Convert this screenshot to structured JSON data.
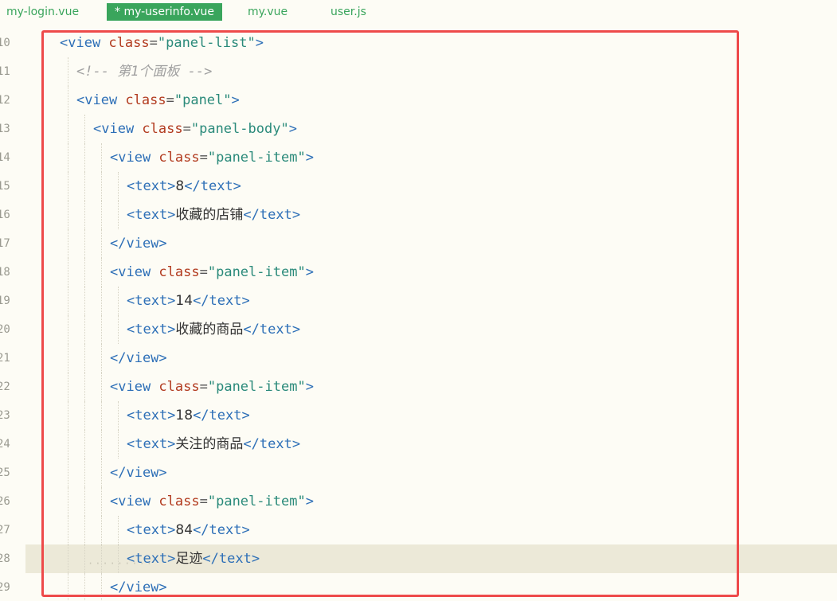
{
  "tabs": [
    {
      "label": "my-login.vue",
      "active": false
    },
    {
      "label": "* my-userinfo.vue",
      "active": true
    },
    {
      "label": "my.vue",
      "active": false
    },
    {
      "label": "user.js",
      "active": false
    }
  ],
  "lines": [
    {
      "num": "10",
      "indent": 0,
      "tokens": [
        [
          "tag",
          "<view "
        ],
        [
          "attr",
          "class"
        ],
        [
          "eq",
          "="
        ],
        [
          "str",
          "\"panel-list\""
        ],
        [
          "tag",
          ">"
        ]
      ]
    },
    {
      "num": "11",
      "indent": 1,
      "tokens": [
        [
          "cmt",
          "<!-- 第1个面板 -->"
        ]
      ]
    },
    {
      "num": "12",
      "indent": 1,
      "tokens": [
        [
          "tag",
          "<view "
        ],
        [
          "attr",
          "class"
        ],
        [
          "eq",
          "="
        ],
        [
          "str",
          "\"panel\""
        ],
        [
          "tag",
          ">"
        ]
      ]
    },
    {
      "num": "13",
      "indent": 2,
      "tokens": [
        [
          "tag",
          "<view "
        ],
        [
          "attr",
          "class"
        ],
        [
          "eq",
          "="
        ],
        [
          "str",
          "\"panel-body\""
        ],
        [
          "tag",
          ">"
        ]
      ]
    },
    {
      "num": "14",
      "indent": 3,
      "tokens": [
        [
          "tag",
          "<view "
        ],
        [
          "attr",
          "class"
        ],
        [
          "eq",
          "="
        ],
        [
          "str",
          "\"panel-item\""
        ],
        [
          "tag",
          ">"
        ]
      ]
    },
    {
      "num": "15",
      "indent": 4,
      "tokens": [
        [
          "tag",
          "<text>"
        ],
        [
          "txt",
          "8"
        ],
        [
          "tag",
          "</text>"
        ]
      ]
    },
    {
      "num": "16",
      "indent": 4,
      "tokens": [
        [
          "tag",
          "<text>"
        ],
        [
          "txt",
          "收藏的店铺"
        ],
        [
          "tag",
          "</text>"
        ]
      ]
    },
    {
      "num": "17",
      "indent": 3,
      "tokens": [
        [
          "tag",
          "</view>"
        ]
      ]
    },
    {
      "num": "18",
      "indent": 3,
      "tokens": [
        [
          "tag",
          "<view "
        ],
        [
          "attr",
          "class"
        ],
        [
          "eq",
          "="
        ],
        [
          "str",
          "\"panel-item\""
        ],
        [
          "tag",
          ">"
        ]
      ]
    },
    {
      "num": "19",
      "indent": 4,
      "tokens": [
        [
          "tag",
          "<text>"
        ],
        [
          "txt",
          "14"
        ],
        [
          "tag",
          "</text>"
        ]
      ]
    },
    {
      "num": "20",
      "indent": 4,
      "tokens": [
        [
          "tag",
          "<text>"
        ],
        [
          "txt",
          "收藏的商品"
        ],
        [
          "tag",
          "</text>"
        ]
      ]
    },
    {
      "num": "21",
      "indent": 3,
      "tokens": [
        [
          "tag",
          "</view>"
        ]
      ]
    },
    {
      "num": "22",
      "indent": 3,
      "tokens": [
        [
          "tag",
          "<view "
        ],
        [
          "attr",
          "class"
        ],
        [
          "eq",
          "="
        ],
        [
          "str",
          "\"panel-item\""
        ],
        [
          "tag",
          ">"
        ]
      ]
    },
    {
      "num": "23",
      "indent": 4,
      "tokens": [
        [
          "tag",
          "<text>"
        ],
        [
          "txt",
          "18"
        ],
        [
          "tag",
          "</text>"
        ]
      ]
    },
    {
      "num": "24",
      "indent": 4,
      "tokens": [
        [
          "tag",
          "<text>"
        ],
        [
          "txt",
          "关注的商品"
        ],
        [
          "tag",
          "</text>"
        ]
      ]
    },
    {
      "num": "25",
      "indent": 3,
      "tokens": [
        [
          "tag",
          "</view>"
        ]
      ]
    },
    {
      "num": "26",
      "indent": 3,
      "tokens": [
        [
          "tag",
          "<view "
        ],
        [
          "attr",
          "class"
        ],
        [
          "eq",
          "="
        ],
        [
          "str",
          "\"panel-item\""
        ],
        [
          "tag",
          ">"
        ]
      ]
    },
    {
      "num": "27",
      "indent": 4,
      "tokens": [
        [
          "tag",
          "<text>"
        ],
        [
          "txt",
          "84"
        ],
        [
          "tag",
          "</text>"
        ]
      ]
    },
    {
      "num": "28",
      "indent": 4,
      "current": true,
      "tokens": [
        [
          "tag",
          "<text>"
        ],
        [
          "txt",
          "足迹"
        ],
        [
          "tag",
          "</text>"
        ]
      ]
    },
    {
      "num": "29",
      "indent": 3,
      "tokens": [
        [
          "tag",
          "</view>"
        ]
      ]
    }
  ]
}
